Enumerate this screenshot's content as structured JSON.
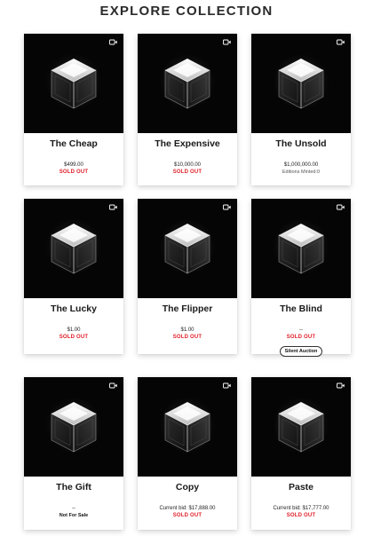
{
  "header": {
    "title": "EXPLORE COLLECTION"
  },
  "cards": [
    {
      "name": "The Cheap",
      "price": "$499.00",
      "status": "SOLD OUT"
    },
    {
      "name": "The Expensive",
      "price": "$10,000.00",
      "status": "SOLD OUT"
    },
    {
      "name": "The Unsold",
      "price": "$1,000,000.00",
      "editions": "Editions Minted:0"
    },
    {
      "name": "The Lucky",
      "price": "$1.00",
      "status": "SOLD OUT"
    },
    {
      "name": "The Flipper",
      "price": "$1.00",
      "status": "SOLD OUT"
    },
    {
      "name": "The Blind",
      "price": "--",
      "status": "SOLD OUT",
      "button": "Silent Auction"
    },
    {
      "name": "The Gift",
      "price": "--",
      "note": "Not For Sale"
    },
    {
      "name": "Copy",
      "price": "Current bid: $17,888.00",
      "status": "SOLD OUT"
    },
    {
      "name": "Paste",
      "price": "Current bid: $17,777.00",
      "status": "SOLD OUT"
    }
  ],
  "icons": {
    "media": "video-camera-icon",
    "artwork": "glowing-cube-icon"
  },
  "colors": {
    "sold_out": "#e0202a",
    "artwork_bg": "#050505",
    "page_bg": "#ffffff"
  }
}
